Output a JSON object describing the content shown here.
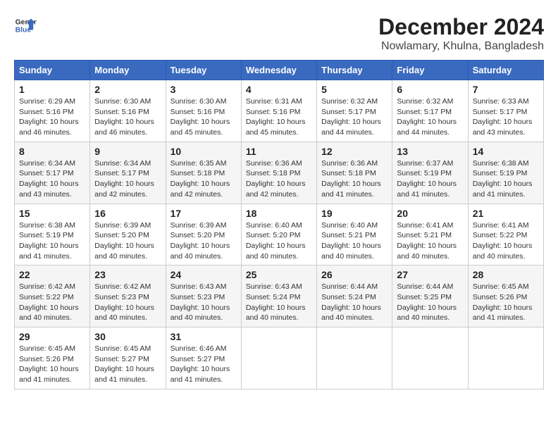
{
  "header": {
    "logo_line1": "General",
    "logo_line2": "Blue",
    "month": "December 2024",
    "location": "Nowlamary, Khulna, Bangladesh"
  },
  "columns": [
    "Sunday",
    "Monday",
    "Tuesday",
    "Wednesday",
    "Thursday",
    "Friday",
    "Saturday"
  ],
  "weeks": [
    [
      {
        "day": "1",
        "sunrise": "6:29 AM",
        "sunset": "5:16 PM",
        "daylight": "10 hours and 46 minutes."
      },
      {
        "day": "2",
        "sunrise": "6:30 AM",
        "sunset": "5:16 PM",
        "daylight": "10 hours and 46 minutes."
      },
      {
        "day": "3",
        "sunrise": "6:30 AM",
        "sunset": "5:16 PM",
        "daylight": "10 hours and 45 minutes."
      },
      {
        "day": "4",
        "sunrise": "6:31 AM",
        "sunset": "5:16 PM",
        "daylight": "10 hours and 45 minutes."
      },
      {
        "day": "5",
        "sunrise": "6:32 AM",
        "sunset": "5:17 PM",
        "daylight": "10 hours and 44 minutes."
      },
      {
        "day": "6",
        "sunrise": "6:32 AM",
        "sunset": "5:17 PM",
        "daylight": "10 hours and 44 minutes."
      },
      {
        "day": "7",
        "sunrise": "6:33 AM",
        "sunset": "5:17 PM",
        "daylight": "10 hours and 43 minutes."
      }
    ],
    [
      {
        "day": "8",
        "sunrise": "6:34 AM",
        "sunset": "5:17 PM",
        "daylight": "10 hours and 43 minutes."
      },
      {
        "day": "9",
        "sunrise": "6:34 AM",
        "sunset": "5:17 PM",
        "daylight": "10 hours and 42 minutes."
      },
      {
        "day": "10",
        "sunrise": "6:35 AM",
        "sunset": "5:18 PM",
        "daylight": "10 hours and 42 minutes."
      },
      {
        "day": "11",
        "sunrise": "6:36 AM",
        "sunset": "5:18 PM",
        "daylight": "10 hours and 42 minutes."
      },
      {
        "day": "12",
        "sunrise": "6:36 AM",
        "sunset": "5:18 PM",
        "daylight": "10 hours and 41 minutes."
      },
      {
        "day": "13",
        "sunrise": "6:37 AM",
        "sunset": "5:19 PM",
        "daylight": "10 hours and 41 minutes."
      },
      {
        "day": "14",
        "sunrise": "6:38 AM",
        "sunset": "5:19 PM",
        "daylight": "10 hours and 41 minutes."
      }
    ],
    [
      {
        "day": "15",
        "sunrise": "6:38 AM",
        "sunset": "5:19 PM",
        "daylight": "10 hours and 41 minutes."
      },
      {
        "day": "16",
        "sunrise": "6:39 AM",
        "sunset": "5:20 PM",
        "daylight": "10 hours and 40 minutes."
      },
      {
        "day": "17",
        "sunrise": "6:39 AM",
        "sunset": "5:20 PM",
        "daylight": "10 hours and 40 minutes."
      },
      {
        "day": "18",
        "sunrise": "6:40 AM",
        "sunset": "5:20 PM",
        "daylight": "10 hours and 40 minutes."
      },
      {
        "day": "19",
        "sunrise": "6:40 AM",
        "sunset": "5:21 PM",
        "daylight": "10 hours and 40 minutes."
      },
      {
        "day": "20",
        "sunrise": "6:41 AM",
        "sunset": "5:21 PM",
        "daylight": "10 hours and 40 minutes."
      },
      {
        "day": "21",
        "sunrise": "6:41 AM",
        "sunset": "5:22 PM",
        "daylight": "10 hours and 40 minutes."
      }
    ],
    [
      {
        "day": "22",
        "sunrise": "6:42 AM",
        "sunset": "5:22 PM",
        "daylight": "10 hours and 40 minutes."
      },
      {
        "day": "23",
        "sunrise": "6:42 AM",
        "sunset": "5:23 PM",
        "daylight": "10 hours and 40 minutes."
      },
      {
        "day": "24",
        "sunrise": "6:43 AM",
        "sunset": "5:23 PM",
        "daylight": "10 hours and 40 minutes."
      },
      {
        "day": "25",
        "sunrise": "6:43 AM",
        "sunset": "5:24 PM",
        "daylight": "10 hours and 40 minutes."
      },
      {
        "day": "26",
        "sunrise": "6:44 AM",
        "sunset": "5:24 PM",
        "daylight": "10 hours and 40 minutes."
      },
      {
        "day": "27",
        "sunrise": "6:44 AM",
        "sunset": "5:25 PM",
        "daylight": "10 hours and 40 minutes."
      },
      {
        "day": "28",
        "sunrise": "6:45 AM",
        "sunset": "5:26 PM",
        "daylight": "10 hours and 41 minutes."
      }
    ],
    [
      {
        "day": "29",
        "sunrise": "6:45 AM",
        "sunset": "5:26 PM",
        "daylight": "10 hours and 41 minutes."
      },
      {
        "day": "30",
        "sunrise": "6:45 AM",
        "sunset": "5:27 PM",
        "daylight": "10 hours and 41 minutes."
      },
      {
        "day": "31",
        "sunrise": "6:46 AM",
        "sunset": "5:27 PM",
        "daylight": "10 hours and 41 minutes."
      },
      null,
      null,
      null,
      null
    ]
  ]
}
